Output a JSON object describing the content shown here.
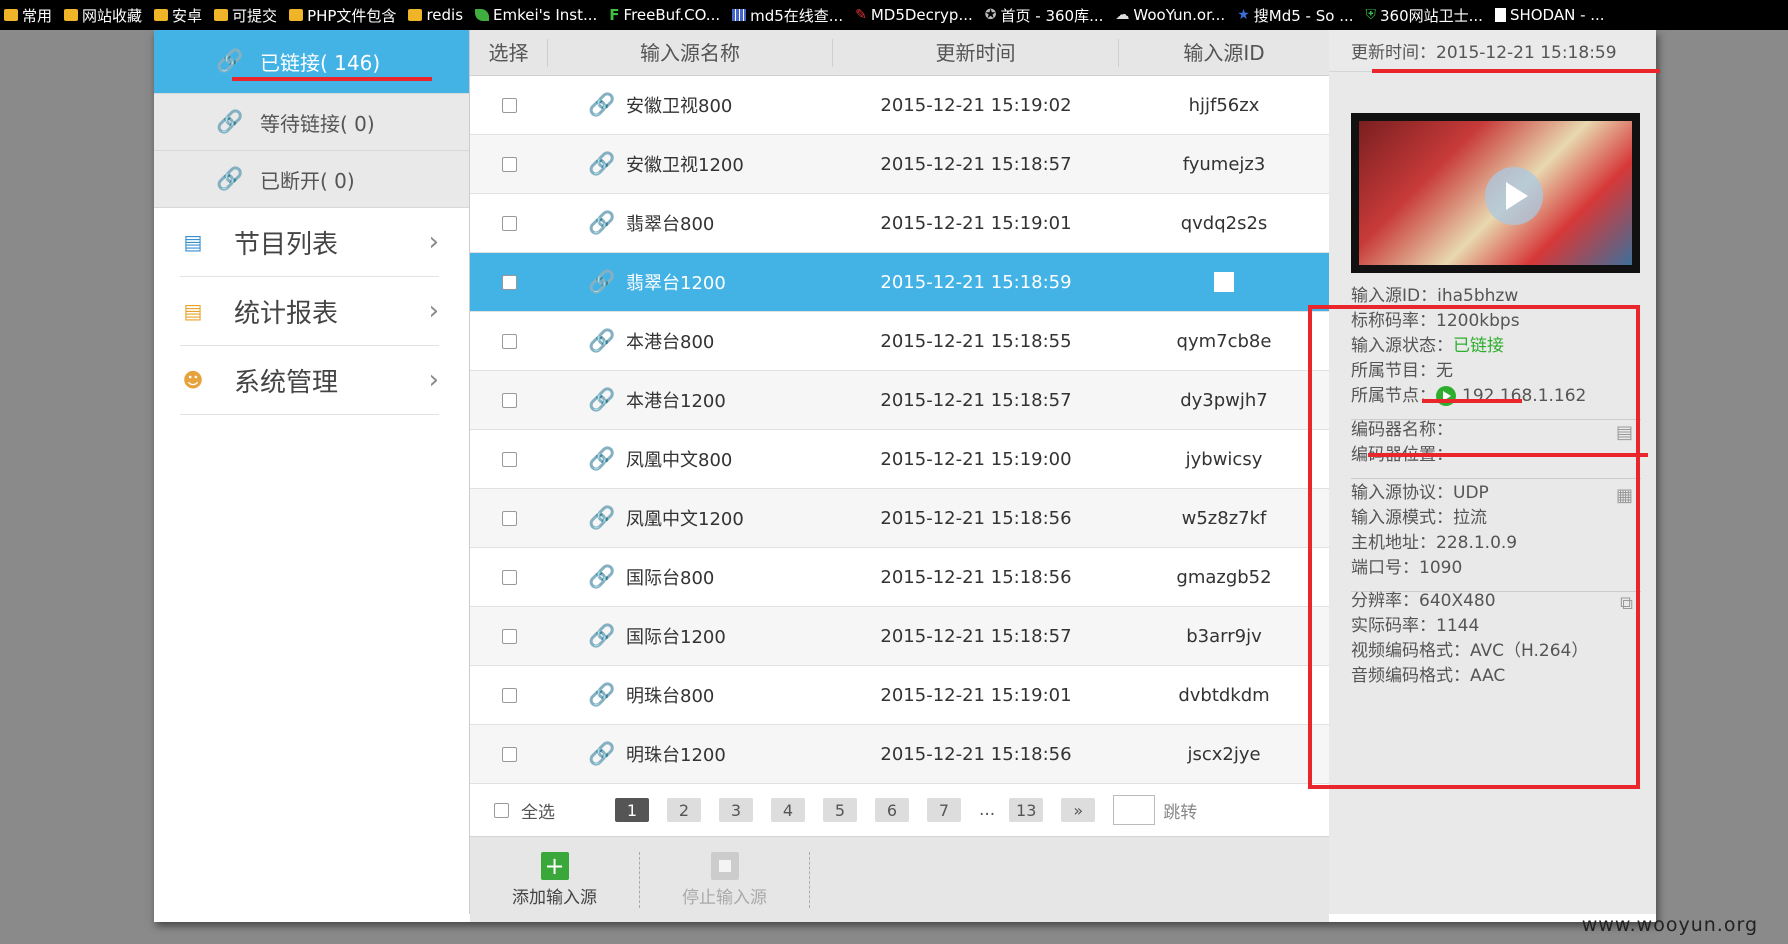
{
  "bookmarks": [
    {
      "label": "常用",
      "icon": "folder-icon"
    },
    {
      "label": "网站收藏",
      "icon": "folder-icon"
    },
    {
      "label": "安卓",
      "icon": "folder-icon"
    },
    {
      "label": "可提交",
      "icon": "folder-icon"
    },
    {
      "label": "PHP文件包含",
      "icon": "folder-icon"
    },
    {
      "label": "redis",
      "icon": "folder-icon"
    },
    {
      "label": "Emkei's Inst...",
      "icon": "leaf-icon"
    },
    {
      "label": "FreeBuf.CO...",
      "icon": "freebuf-icon"
    },
    {
      "label": "md5在线查...",
      "icon": "grid-icon"
    },
    {
      "label": "MD5Decryp...",
      "icon": "md5-icon"
    },
    {
      "label": "首页 - 360库...",
      "icon": "star-icon"
    },
    {
      "label": "WooYun.or...",
      "icon": "cloud-icon"
    },
    {
      "label": "搜Md5 - So ...",
      "icon": "search-md5-icon"
    },
    {
      "label": "360网站卫士...",
      "icon": "shield-icon"
    },
    {
      "label": "SHODAN - ...",
      "icon": "document-icon"
    }
  ],
  "sidebar": {
    "status": [
      {
        "label": "已链接( 146)",
        "state": "connected"
      },
      {
        "label": "等待链接( 0)",
        "state": "waiting"
      },
      {
        "label": "已断开( 0)",
        "state": "disconnected"
      }
    ],
    "nav": [
      {
        "label": "节目列表",
        "icon": "program-list-icon"
      },
      {
        "label": "统计报表",
        "icon": "report-chart-icon"
      },
      {
        "label": "系统管理",
        "icon": "users-admin-icon"
      }
    ]
  },
  "table": {
    "headers": {
      "select": "选择",
      "name": "输入源名称",
      "time": "更新时间",
      "id": "输入源ID"
    },
    "rows": [
      {
        "name": "安徽卫视800",
        "time": "2015-12-21 15:19:02",
        "id": "hjjf56zx",
        "selected": false
      },
      {
        "name": "安徽卫视1200",
        "time": "2015-12-21 15:18:57",
        "id": "fyumejz3",
        "selected": false
      },
      {
        "name": "翡翠台800",
        "time": "2015-12-21 15:19:01",
        "id": "qvdq2s2s",
        "selected": false
      },
      {
        "name": "翡翠台1200",
        "time": "2015-12-21 15:18:59",
        "id": "",
        "selected": true
      },
      {
        "name": "本港台800",
        "time": "2015-12-21 15:18:55",
        "id": "qym7cb8e",
        "selected": false
      },
      {
        "name": "本港台1200",
        "time": "2015-12-21 15:18:57",
        "id": "dy3pwjh7",
        "selected": false
      },
      {
        "name": "凤凰中文800",
        "time": "2015-12-21 15:19:00",
        "id": "jybwicsy",
        "selected": false
      },
      {
        "name": "凤凰中文1200",
        "time": "2015-12-21 15:18:56",
        "id": "w5z8z7kf",
        "selected": false
      },
      {
        "name": "国际台800",
        "time": "2015-12-21 15:18:56",
        "id": "gmazgb52",
        "selected": false
      },
      {
        "name": "国际台1200",
        "time": "2015-12-21 15:18:57",
        "id": "b3arr9jv",
        "selected": false
      },
      {
        "name": "明珠台800",
        "time": "2015-12-21 15:19:01",
        "id": "dvbtdkdm",
        "selected": false
      },
      {
        "name": "明珠台1200",
        "time": "2015-12-21 15:18:56",
        "id": "jscx2jye",
        "selected": false
      }
    ]
  },
  "pager": {
    "select_all": "全选",
    "pages": [
      "1",
      "2",
      "3",
      "4",
      "5",
      "6",
      "7"
    ],
    "current": "1",
    "ellipsis": "...",
    "last": "13",
    "next": "»",
    "jump": "跳转"
  },
  "toolbar": {
    "add": "添加输入源",
    "stop": "停止输入源"
  },
  "detail": {
    "update_time": "更新时间：2015-12-21 15:18:59",
    "source_id": "输入源ID：iha5bhzw",
    "bitrate": "标称码率：1200kbps",
    "status_label": "输入源状态：",
    "status_value": "已链接",
    "program": "所属节目：无",
    "node_label": "所属节点：",
    "node_value": "192.168.1.162",
    "encoder_name": "编码器名称：",
    "encoder_pos": "编码器位置：",
    "protocol": "输入源协议：UDP",
    "mode": "输入源模式：拉流",
    "host": "主机地址：228.1.0.9",
    "port": "端口号：1090",
    "resolution": "分辨率：640X480",
    "actual_bitrate": "实际码率：1144",
    "video_codec": "视频编码格式：AVC（H.264）",
    "audio_codec": "音频编码格式：AAC"
  },
  "watermark": "www.wooyun.org",
  "colors": {
    "accent_blue": "#43b3e6",
    "ok_green": "#2eae2e",
    "highlight_red": "#e8262b"
  }
}
